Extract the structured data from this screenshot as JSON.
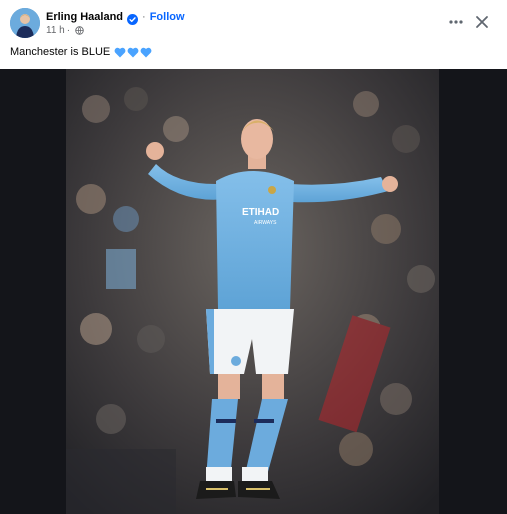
{
  "post": {
    "author": "Erling Haaland",
    "separator": "·",
    "follow_label": "Follow",
    "timestamp": "11 h",
    "meta_separator": "·",
    "caption_text": "Manchester is BLUE",
    "caption_emojis": [
      "blue-heart-icon",
      "blue-heart-icon",
      "blue-heart-icon"
    ],
    "shirt_sponsor": "ETIHAD",
    "shirt_sponsor_sub": "AIRWAYS"
  },
  "icons": {
    "verified": "verified-badge-icon",
    "audience": "globe-icon",
    "more": "more-options-icon",
    "close": "close-icon"
  },
  "colors": {
    "follow": "#0866ff",
    "verified": "#0866ff",
    "secondary_text": "#65676b",
    "heart": "#4aa3ff",
    "kit_blue": "#6cabdd",
    "media_background": "#14151a"
  }
}
